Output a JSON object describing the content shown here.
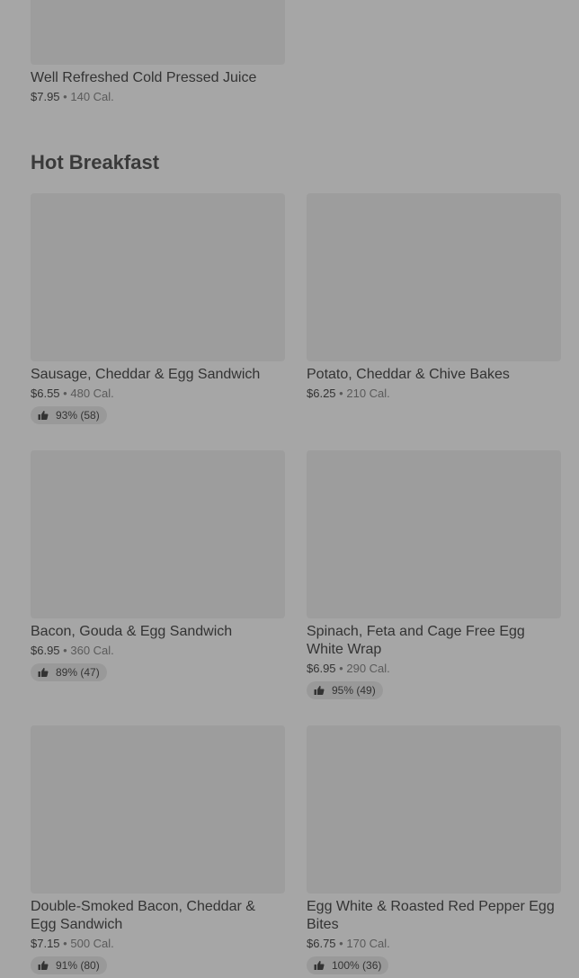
{
  "top_item": {
    "name": "Well Refreshed Cold Pressed Juice",
    "price": "$7.95",
    "separator": "•",
    "calories": "140 Cal."
  },
  "section": {
    "title": "Hot Breakfast"
  },
  "items": [
    {
      "name": "Sausage, Cheddar & Egg Sandwich",
      "price": "$6.55",
      "separator": "•",
      "calories": "480 Cal.",
      "rating": "93% (58)"
    },
    {
      "name": "Potato, Cheddar & Chive Bakes",
      "price": "$6.25",
      "separator": "•",
      "calories": "210 Cal."
    },
    {
      "name": "Bacon, Gouda & Egg Sandwich",
      "price": "$6.95",
      "separator": "•",
      "calories": "360 Cal.",
      "rating": "89% (47)"
    },
    {
      "name": "Spinach, Feta and Cage Free Egg White Wrap",
      "price": "$6.95",
      "separator": "•",
      "calories": "290 Cal.",
      "rating": "95% (49)"
    },
    {
      "name": "Double-Smoked Bacon, Cheddar & Egg Sandwich",
      "price": "$7.15",
      "separator": "•",
      "calories": "500 Cal.",
      "rating": "91% (80)"
    },
    {
      "name": "Egg White & Roasted Red Pepper Egg Bites",
      "price": "$6.75",
      "separator": "•",
      "calories": "170 Cal.",
      "rating": "100% (36)"
    }
  ],
  "icons": {
    "rating": "thumbs-up-icon"
  },
  "colors": {
    "background": "#a6a6a6",
    "image_placeholder": "#9d9d9d",
    "rating_pill": "#999999",
    "text": "#333333"
  }
}
